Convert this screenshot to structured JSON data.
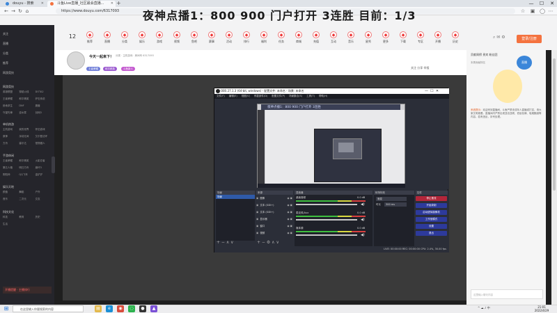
{
  "browser": {
    "tabs": [
      {
        "label": "douyu - 搜索",
        "color": "#3b86d9"
      },
      {
        "label": "斗鱼Live直播_社区最会直播...",
        "color": "#f4723f"
      }
    ],
    "address": "https://www.douyu.com/6317093",
    "window_controls": [
      "—",
      "☐",
      "✕"
    ]
  },
  "banner": {
    "overlay_text": "夜神点播1：800 900 门户打开 3连胜 目前：1/3",
    "nav_count": "12",
    "nav_items": [
      "推荐",
      "直播",
      "分类",
      "娱乐",
      "游戏",
      "视频",
      "鱼吧",
      "赛事",
      "活动",
      "排行",
      "福利",
      "任务",
      "商城",
      "充值",
      "互动",
      "音乐",
      "星秀",
      "更多",
      "下载",
      "专区",
      "开播",
      "历史"
    ],
    "login_label": "登录/注册"
  },
  "sidebar": {
    "items": [
      "关注",
      "直播",
      "分类",
      "推荐",
      "网游竞技"
    ],
    "sections": [
      {
        "head": "网游竞技",
        "cells": [
          "英雄联盟",
          "穿越火线",
          "DOTA2",
          "王者荣耀",
          "和平精英",
          "炉石传说",
          "绝地求生",
          "DNF",
          "魔兽",
          "守望先锋",
          "逆水寒",
          "剑网3"
        ]
      },
      {
        "head": "单机热游",
        "cells": [
          "主机游戏",
          "我的世界",
          "怀旧游戏",
          "原神",
          "永劫无间",
          "艾尔登法环",
          "方舟",
          "塞尔达",
          "怪物猎人"
        ]
      },
      {
        "head": "手游休闲",
        "cells": [
          "王者荣耀",
          "和平精英",
          "火影忍者",
          "第五人格",
          "明日方舟",
          "崩坏3",
          "阴阳师",
          "QQ飞车",
          "金铲铲"
        ]
      },
      {
        "head": "娱乐天地",
        "cells": [
          "颜值",
          "舞蹈",
          "户外",
          "音乐",
          "二次元",
          "交友"
        ]
      },
      {
        "head": "科技文化",
        "cells": [
          "科技",
          "教育",
          "历史",
          "生活"
        ]
      }
    ],
    "live_label": "开播提醒 · 主播排行"
  },
  "streamer": {
    "room_title": "今天一起来下！",
    "room_meta": "分类 · 主机游戏 · 房间号 6317093",
    "tags": [
      "王者荣耀",
      "和平精英",
      "主机游戏 · 热",
      "斗鱼新人"
    ],
    "actions": "关注  分享  举报"
  },
  "obs": {
    "title": "OBS 27.1.3 (64-bit, windows) - 配置文件: 未命名 - 场景: 未命名",
    "menu": [
      "文件(F)",
      "编辑(E)",
      "视图(V)",
      "停靠部件(D)",
      "配置文件(P)",
      "场景集合(S)",
      "工具(T)",
      "帮助(H)"
    ],
    "nested_overlay": "夜神点播1：800 900 门户打开 3连胜",
    "docks": {
      "scenes": "场景",
      "sources": "来源",
      "mixer": "混音器",
      "transitions": "转场特效",
      "controls": "控件"
    },
    "scene_name": "场景",
    "source_rows": [
      "图像",
      "文本 (GDI+)",
      "文本 (GDI+)",
      "显示器",
      "窗口",
      "视频"
    ],
    "mixer_channels": [
      {
        "name": "桌面音频",
        "db": "0.0 dB"
      },
      {
        "name": "麦克风/Aux",
        "db": "0.0 dB"
      },
      {
        "name": "媒体源",
        "db": "0.0 dB"
      }
    ],
    "transition_value": "渐变",
    "duration_label": "时长",
    "duration_value": "300 ms",
    "controls": [
      "停止推流",
      "开始录制",
      "启动虚拟摄像机",
      "工作室模式",
      "设置",
      "退出"
    ],
    "status": "LIVE: 00:00:00    REC: 00:00:00    CPU: 2.4%, 30.00 fps"
  },
  "right": {
    "rank_tabs": "贡献周榜  贵宾  粉丝团",
    "rank_sub": "本周贡献排名",
    "badge": "直播",
    "notice_label": "系统提示：",
    "notice": "欢迎来到直播间，斗鱼严禁未成年人直播或打赏，请大家文明观看。直播间内严禁出现违法违规、低俗色情、吸烟酗酒等内容，若有违反，封号处理。",
    "chat_placeholder": "这里输入聊天内容"
  },
  "taskbar": {
    "search_placeholder": "在这里输入你要搜索的内容",
    "apps": [
      {
        "name": "file-explorer-icon",
        "color": "#e3b84a",
        "glyph": "▤"
      },
      {
        "name": "edge-icon",
        "color": "#1a8fd6",
        "glyph": "e"
      },
      {
        "name": "chrome-icon",
        "color": "#d94a3a",
        "glyph": "◉"
      },
      {
        "name": "wechat-icon",
        "color": "#2bb24c",
        "glyph": "◌"
      },
      {
        "name": "obs-icon",
        "color": "#333333",
        "glyph": "●"
      },
      {
        "name": "game-icon",
        "color": "#7a4fd6",
        "glyph": "▲"
      }
    ],
    "tray": "^  ☁  ♪  中  ",
    "time": "21:01",
    "date": "2022/4/29"
  }
}
